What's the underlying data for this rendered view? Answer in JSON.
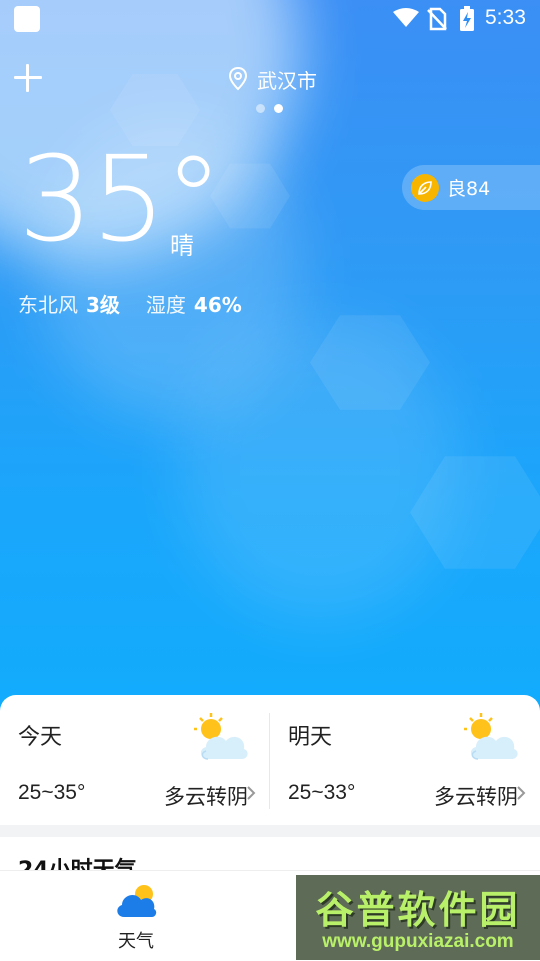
{
  "status_bar": {
    "time": "5:33",
    "icons": [
      "app-square-icon",
      "wifi-icon",
      "no-sim-icon",
      "battery-charging-icon"
    ]
  },
  "header": {
    "city": "武汉市",
    "page_count": 2,
    "active_page": 2
  },
  "current": {
    "temperature": "35°",
    "condition": "晴",
    "aqi_label": "良84",
    "wind_label": "东北风",
    "wind_value": "3级",
    "humidity_label": "湿度",
    "humidity_value": "46%"
  },
  "forecast": [
    {
      "day": "今天",
      "range": "25~35°",
      "desc": "多云转阴",
      "icon": "partly-cloudy-icon"
    },
    {
      "day": "明天",
      "range": "25~33°",
      "desc": "多云转阴",
      "icon": "partly-cloudy-icon"
    }
  ],
  "section": {
    "title": "24小时天气"
  },
  "bottom_nav": {
    "items": [
      {
        "label": "天气",
        "icon": "weather-cloud-icon"
      }
    ]
  },
  "watermark": {
    "title": "谷普软件园",
    "url": "www.gupuxiazai.com"
  },
  "colors": {
    "sky_top": "#3b8ff5",
    "sky_bottom": "#12acfd",
    "aqi_badge": "#f7b500"
  }
}
